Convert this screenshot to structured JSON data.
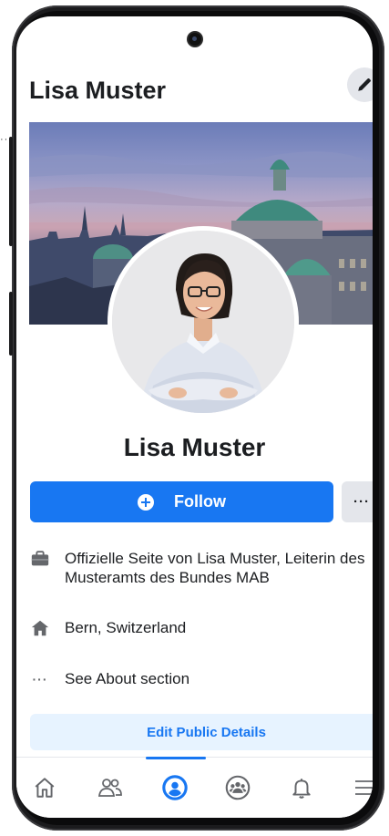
{
  "header": {
    "title": "Lisa Muster"
  },
  "profile": {
    "name": "Lisa Muster"
  },
  "actions": {
    "follow_label": "Follow",
    "more_label": "···"
  },
  "info": [
    {
      "icon": "briefcase-icon",
      "text": "Offizielle Seite von Lisa Muster, Leiterin des Musteramts des Bundes MAB"
    },
    {
      "icon": "home-icon",
      "text": "Bern, Switzerland"
    },
    {
      "icon": "more-dots-icon",
      "text": "See About section"
    }
  ],
  "edit_details_label": "Edit Public Details",
  "tabs": [
    {
      "icon": "home-outline-icon",
      "active": false
    },
    {
      "icon": "friends-icon",
      "active": false
    },
    {
      "icon": "profile-icon",
      "active": true
    },
    {
      "icon": "groups-icon",
      "active": false
    },
    {
      "icon": "bell-icon",
      "active": false
    },
    {
      "icon": "menu-icon",
      "active": false
    }
  ],
  "colors": {
    "accent": "#1877f2",
    "text": "#1c1e21",
    "secondary_bg": "#e4e6eb",
    "light_blue_bg": "#e7f3ff"
  }
}
